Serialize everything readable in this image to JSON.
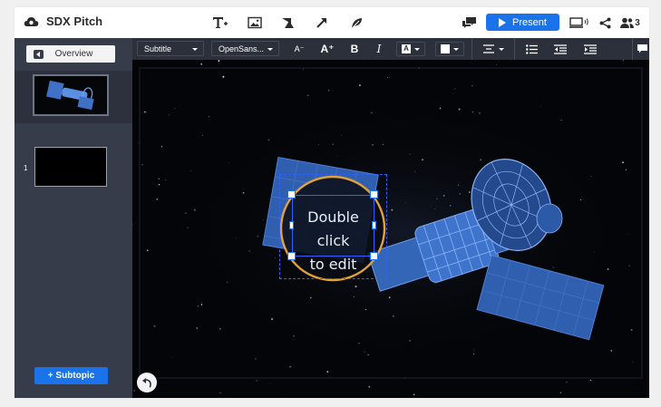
{
  "app": {
    "title": "SDX Pitch",
    "accent_color": "#1a73e8",
    "sidebar_color": "#363c4a"
  },
  "topbar": {
    "tools": [
      {
        "icon": "text-tool-icon",
        "label": "T+"
      },
      {
        "icon": "image-tool-icon"
      },
      {
        "icon": "shapes-tool-icon"
      },
      {
        "icon": "arrow-tool-icon"
      },
      {
        "icon": "leaf-tool-icon"
      }
    ],
    "comments_icon": "comments-icon",
    "present_label": "Present",
    "preview_icon": "device-preview-icon",
    "share_icon": "share-icon",
    "collaborators_count": "3"
  },
  "sidebar": {
    "overview_label": "Overview",
    "slides": [
      {
        "number": "1"
      }
    ],
    "subtopic_label": "+ Subtopic"
  },
  "format_toolbar": {
    "style_value": "Subtitle",
    "font_value": "OpenSans...",
    "decrease_font_label": "A⁻",
    "increase_font_label": "A⁺",
    "bold_label": "B",
    "italic_label": "I",
    "text_color_label": "A"
  },
  "canvas": {
    "textbox_line1": "Double click",
    "textbox_line2": "to edit"
  }
}
